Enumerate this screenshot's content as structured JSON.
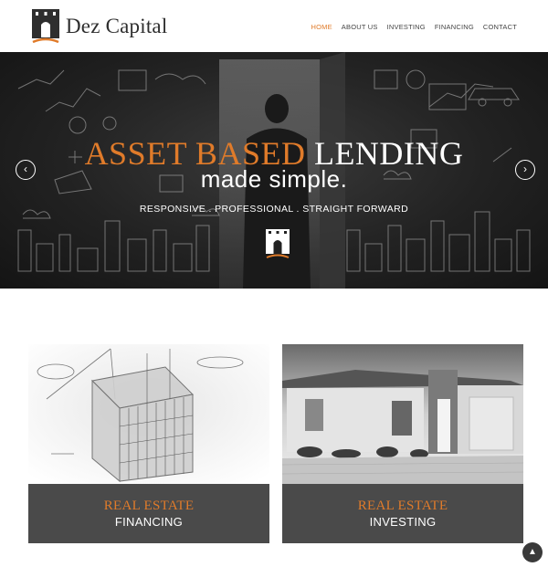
{
  "brand": {
    "name": "Dez Capital",
    "accent": "#e07b2a"
  },
  "nav": {
    "items": [
      {
        "label": "HOME",
        "active": true
      },
      {
        "label": "ABOUT US",
        "active": false
      },
      {
        "label": "INVESTING",
        "active": false
      },
      {
        "label": "FINANCING",
        "active": false
      },
      {
        "label": "CONTACT",
        "active": false
      }
    ]
  },
  "hero": {
    "title_accent": "ASSET BASED",
    "title_rest": "LENDING",
    "subtitle": "made simple.",
    "tagline": "RESPONSIVE . PROFESSIONAL . STRAIGHT FORWARD",
    "prev_icon": "chevron-left-icon",
    "next_icon": "chevron-right-icon"
  },
  "cards": [
    {
      "line1": "REAL ESTATE",
      "line2": "FINANCING"
    },
    {
      "line1": "REAL ESTATE",
      "line2": "INVESTING"
    }
  ],
  "scroll_top_icon": "chevron-up-icon"
}
